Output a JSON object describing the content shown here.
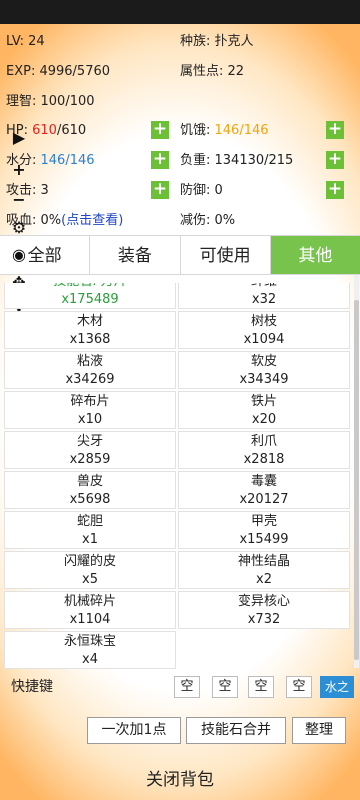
{
  "stats": {
    "lv_label": "LV: 24",
    "race_label": "种族: 扑克人",
    "exp_label": "EXP: 4996/5760",
    "attr_points_label": "属性点: 22",
    "sanity_label": "理智: 100/100",
    "hp_prefix": "HP:",
    "hp_current": "610",
    "hp_max": "/610",
    "hunger_prefix": "饥饿: ",
    "hunger_current": "146",
    "hunger_max": "/146",
    "water_prefix": "水分: ",
    "water_current": "146",
    "water_max": "/146",
    "load_label": "负重: 134130/215",
    "attack_label": "攻击: 3",
    "defense_label": "防御: 0",
    "absorb_prefix": "吸血: 0%",
    "absorb_link": "(点击查看)",
    "damage_reduce_label": "减伤: 0%"
  },
  "tabs": [
    {
      "label": "全部",
      "active": false
    },
    {
      "label": "装备",
      "active": false
    },
    {
      "label": "可使用",
      "active": false
    },
    {
      "label": "其他",
      "active": true
    }
  ],
  "items": [
    {
      "name": "技能石: 万片",
      "count": "x175489"
    },
    {
      "name": "纤维",
      "count": "x32"
    },
    {
      "name": "木材",
      "count": "x1368"
    },
    {
      "name": "树枝",
      "count": "x1094"
    },
    {
      "name": "粘液",
      "count": "x34269"
    },
    {
      "name": "软皮",
      "count": "x34349"
    },
    {
      "name": "碎布片",
      "count": "x10"
    },
    {
      "name": "铁片",
      "count": "x20"
    },
    {
      "name": "尖牙",
      "count": "x2859"
    },
    {
      "name": "利爪",
      "count": "x2818"
    },
    {
      "name": "兽皮",
      "count": "x5698"
    },
    {
      "name": "毒囊",
      "count": "x20127"
    },
    {
      "name": "蛇胆",
      "count": "x1"
    },
    {
      "name": "甲壳",
      "count": "x15499"
    },
    {
      "name": "闪耀的皮",
      "count": "x5"
    },
    {
      "name": "神性结晶",
      "count": "x2"
    },
    {
      "name": "机械碎片",
      "count": "x1104"
    },
    {
      "name": "变异核心",
      "count": "x732"
    },
    {
      "name": "永恒珠宝",
      "count": "x4"
    }
  ],
  "quickbar": {
    "label": "快捷键",
    "slots": [
      "空",
      "空",
      "空",
      "空",
      "水之"
    ]
  },
  "buttons": {
    "add_one": "一次加1点",
    "merge_skill_stones": "技能石合并",
    "sort": "整理",
    "close_bag": "关闭背包"
  },
  "side_icons": [
    "play-icon",
    "plus-icon",
    "minus-icon",
    "gear-icon",
    "eye-icon",
    "move-icon",
    "close-icon"
  ],
  "colors": {
    "green": "#6cc038",
    "active_tab": "#77c34b",
    "hp_red": "#e0241d",
    "water_blue": "#2b7fd4",
    "hunger_orange": "#f0a410",
    "link_blue": "#1f46c8",
    "first_item_green": "#2b9e39",
    "quick_slot_blue": "#2c8fd6"
  }
}
